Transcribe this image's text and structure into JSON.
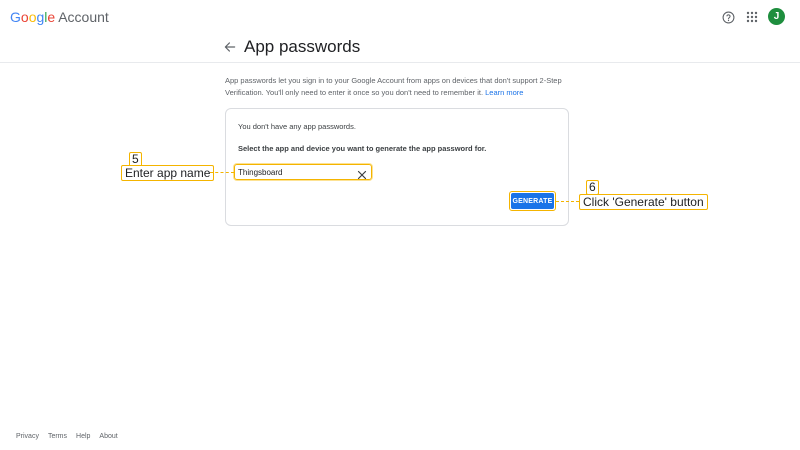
{
  "header": {
    "logo_letters": [
      "G",
      "o",
      "o",
      "g",
      "l",
      "e"
    ],
    "product_name": "Account",
    "avatar_initial": "J",
    "icons": {
      "help": "help-circle-icon",
      "apps": "apps-grid-icon"
    }
  },
  "page": {
    "title": "App passwords",
    "description": "App passwords let you sign in to your Google Account from apps on devices that don't support 2-Step Verification. You'll only need to enter it once so you don't need to remember it.",
    "learn_more": "Learn more"
  },
  "card": {
    "no_passwords_text": "You don't have any app passwords.",
    "select_text": "Select the app and device you want to generate the app password for.",
    "app_name_value": "Thingsboard",
    "generate_label": "GENERATE"
  },
  "annotations": {
    "step5_number": "5",
    "step5_text": "Enter app name",
    "step6_number": "6",
    "step6_text": "Click 'Generate' button"
  },
  "footer": {
    "links": [
      "Privacy",
      "Terms",
      "Help",
      "About"
    ]
  },
  "colors": {
    "accent": "#1a73e8",
    "annotation": "#f4b400",
    "avatar": "#1e8e3e"
  }
}
